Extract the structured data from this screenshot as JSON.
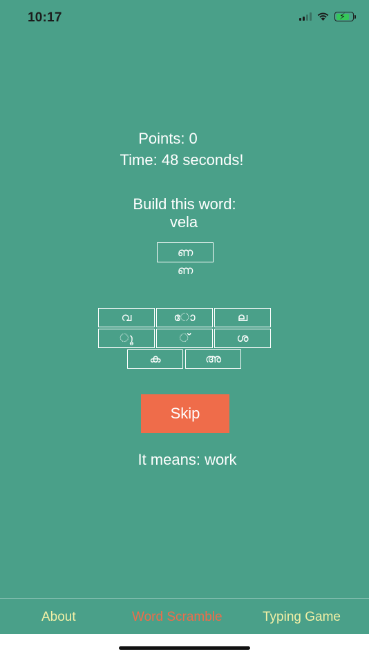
{
  "status_bar": {
    "time": "10:17"
  },
  "game": {
    "points": "Points: 0",
    "timer": "Time: 48 seconds!",
    "build_prompt": "Build this word:",
    "target_word": "vela",
    "answer_box": "ണ",
    "answer_text": "ണ",
    "tiles": [
      "വ",
      "ോ",
      "ല",
      "ൂ",
      "്",
      "ശ",
      "ക",
      "അ"
    ],
    "skip_label": "Skip",
    "meaning": "It means: work"
  },
  "tab_bar": {
    "tabs": [
      {
        "label": "About",
        "color": "#f2f0a6"
      },
      {
        "label": "Word Scramble",
        "color": "#ef6c4a",
        "selected": true
      },
      {
        "label": "Typing Game",
        "color": "#f2f0a6"
      }
    ]
  },
  "colors": {
    "background": "#4aa089",
    "accent": "#ef6c4a",
    "tab_inactive": "#f2f0a6"
  }
}
